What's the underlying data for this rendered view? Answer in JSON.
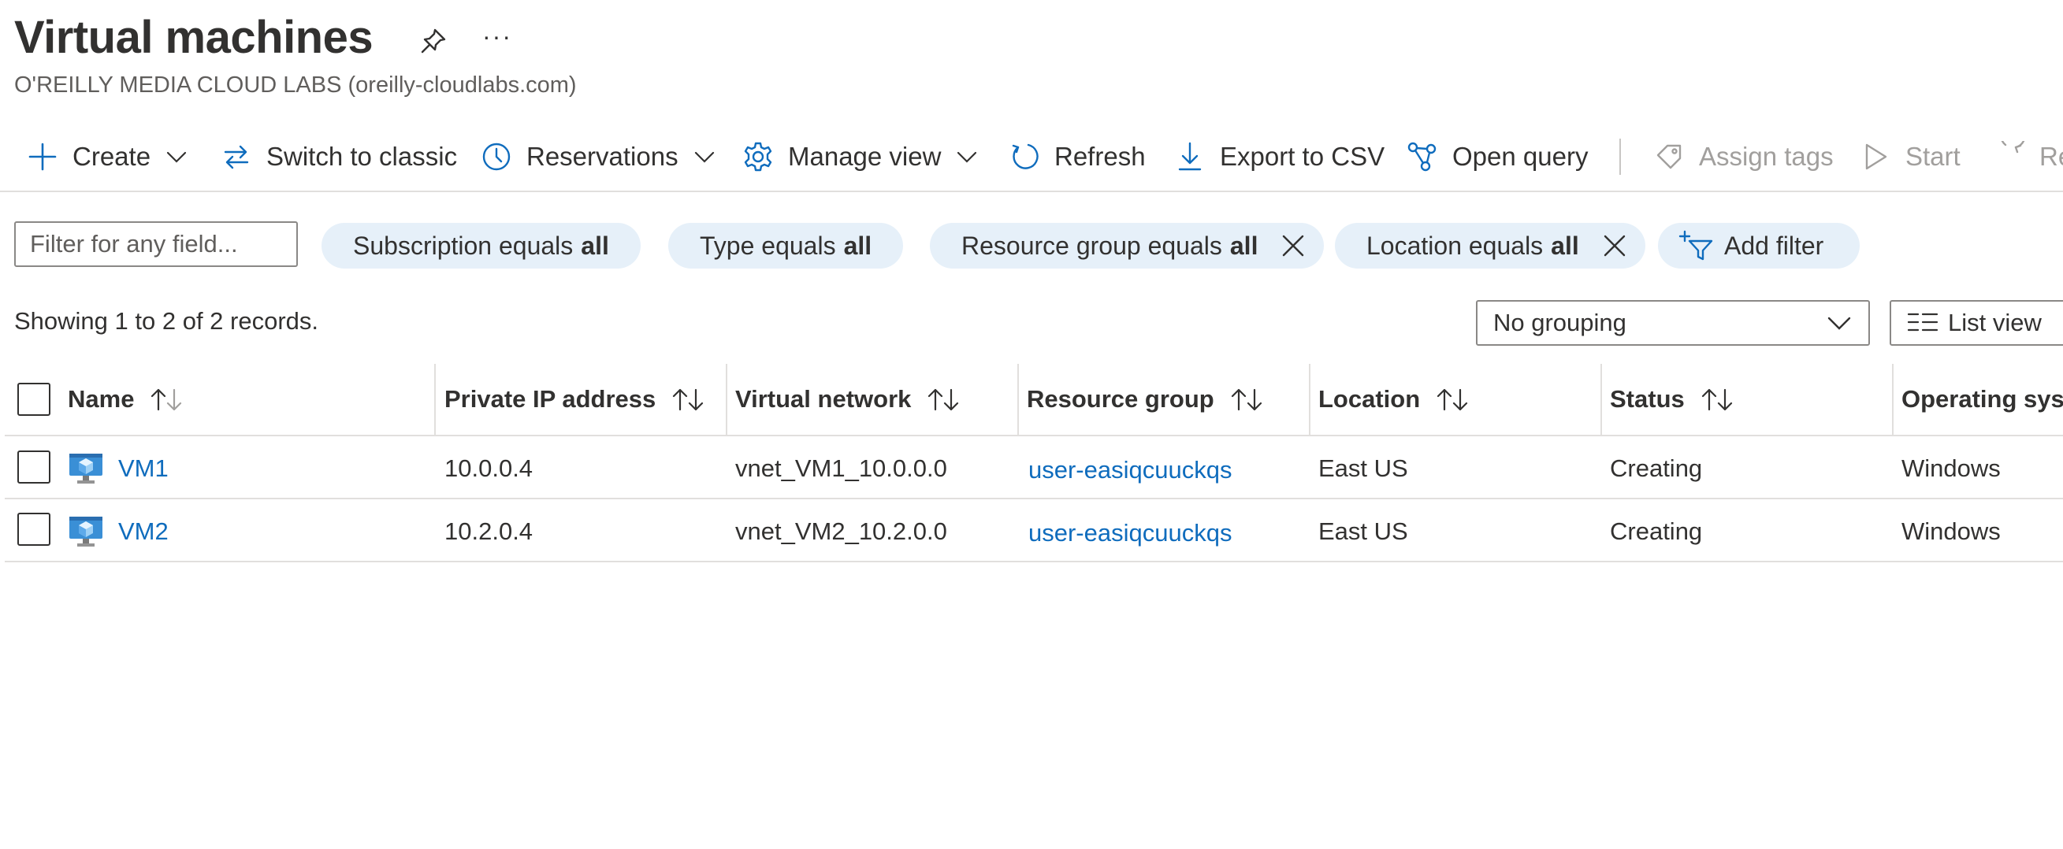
{
  "header": {
    "title": "Virtual machines",
    "more": "···",
    "subtitle": "O'REILLY MEDIA CLOUD LABS (oreilly-cloudlabs.com)"
  },
  "toolbar": {
    "create": "Create",
    "switch_classic": "Switch to classic",
    "reservations": "Reservations",
    "manage_view": "Manage view",
    "refresh": "Refresh",
    "export_csv": "Export to CSV",
    "open_query": "Open query",
    "assign_tags": "Assign tags",
    "start": "Start",
    "restart_partial": "Re"
  },
  "filters": {
    "placeholder": "Filter for any field...",
    "pills": [
      {
        "label": "Subscription equals",
        "value": "all"
      },
      {
        "label": "Type equals",
        "value": "all"
      },
      {
        "label": "Resource group equals",
        "value": "all"
      },
      {
        "label": "Location equals",
        "value": "all"
      }
    ],
    "add_filter": "Add filter"
  },
  "records": {
    "summary": "Showing 1 to 2 of 2 records.",
    "grouping": "No grouping",
    "view": "List view"
  },
  "table": {
    "columns": [
      "Name",
      "Private IP address",
      "Virtual network",
      "Resource group",
      "Location",
      "Status",
      "Operating syst"
    ],
    "rows": [
      {
        "name": "VM1",
        "ip": "10.0.0.4",
        "vnet": "vnet_VM1_10.0.0.0",
        "rg": "user-easiqcuuckqs",
        "location": "East US",
        "status": "Creating",
        "os": "Windows"
      },
      {
        "name": "VM2",
        "ip": "10.2.0.4",
        "vnet": "vnet_VM2_10.2.0.0",
        "rg": "user-easiqcuuckqs",
        "location": "East US",
        "status": "Creating",
        "os": "Windows"
      }
    ]
  },
  "colors": {
    "accent": "#0f6cbd",
    "pill_bg": "#e6f0f9",
    "text": "#323130",
    "disabled": "#a19f9d"
  }
}
